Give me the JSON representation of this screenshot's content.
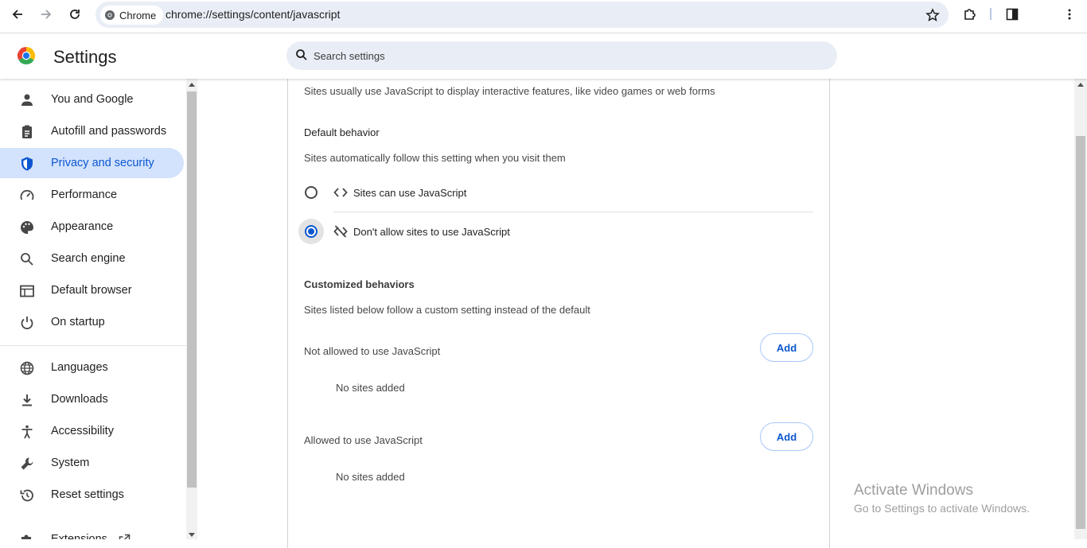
{
  "browser": {
    "chip_label": "Chrome",
    "url": "chrome://settings/content/javascript"
  },
  "header": {
    "title": "Settings",
    "search_placeholder": "Search settings"
  },
  "sidebar": {
    "items": [
      {
        "label": "You and Google",
        "icon": "person-icon"
      },
      {
        "label": "Autofill and passwords",
        "icon": "clipboard-icon"
      },
      {
        "label": "Privacy and security",
        "icon": "shield-icon",
        "active": true
      },
      {
        "label": "Performance",
        "icon": "speedometer-icon"
      },
      {
        "label": "Appearance",
        "icon": "palette-icon"
      },
      {
        "label": "Search engine",
        "icon": "search-icon"
      },
      {
        "label": "Default browser",
        "icon": "browser-window-icon"
      },
      {
        "label": "On startup",
        "icon": "power-icon"
      },
      {
        "label": "Languages",
        "icon": "globe-icon"
      },
      {
        "label": "Downloads",
        "icon": "download-icon"
      },
      {
        "label": "Accessibility",
        "icon": "accessibility-icon"
      },
      {
        "label": "System",
        "icon": "wrench-icon"
      },
      {
        "label": "Reset settings",
        "icon": "history-icon"
      },
      {
        "label": "Extensions",
        "icon": "puzzle-icon"
      }
    ]
  },
  "content": {
    "intro": "Sites usually use JavaScript to display interactive features, like video games or web forms",
    "default_heading": "Default behavior",
    "default_desc": "Sites automatically follow this setting when you visit them",
    "option_allow": "Sites can use JavaScript",
    "option_block": "Don't allow sites to use JavaScript",
    "selected_option": "block",
    "custom_heading": "Customized behaviors",
    "custom_desc": "Sites listed below follow a custom setting instead of the default",
    "not_allowed_label": "Not allowed to use JavaScript",
    "allowed_label": "Allowed to use JavaScript",
    "add_label": "Add",
    "no_sites": "No sites added"
  },
  "watermark": {
    "line1": "Activate Windows",
    "line2": "Go to Settings to activate Windows."
  },
  "colors": {
    "accent": "#0b57d0",
    "active_nav_bg": "#d3e3fd",
    "omnibox_bg": "#e9eef6"
  }
}
